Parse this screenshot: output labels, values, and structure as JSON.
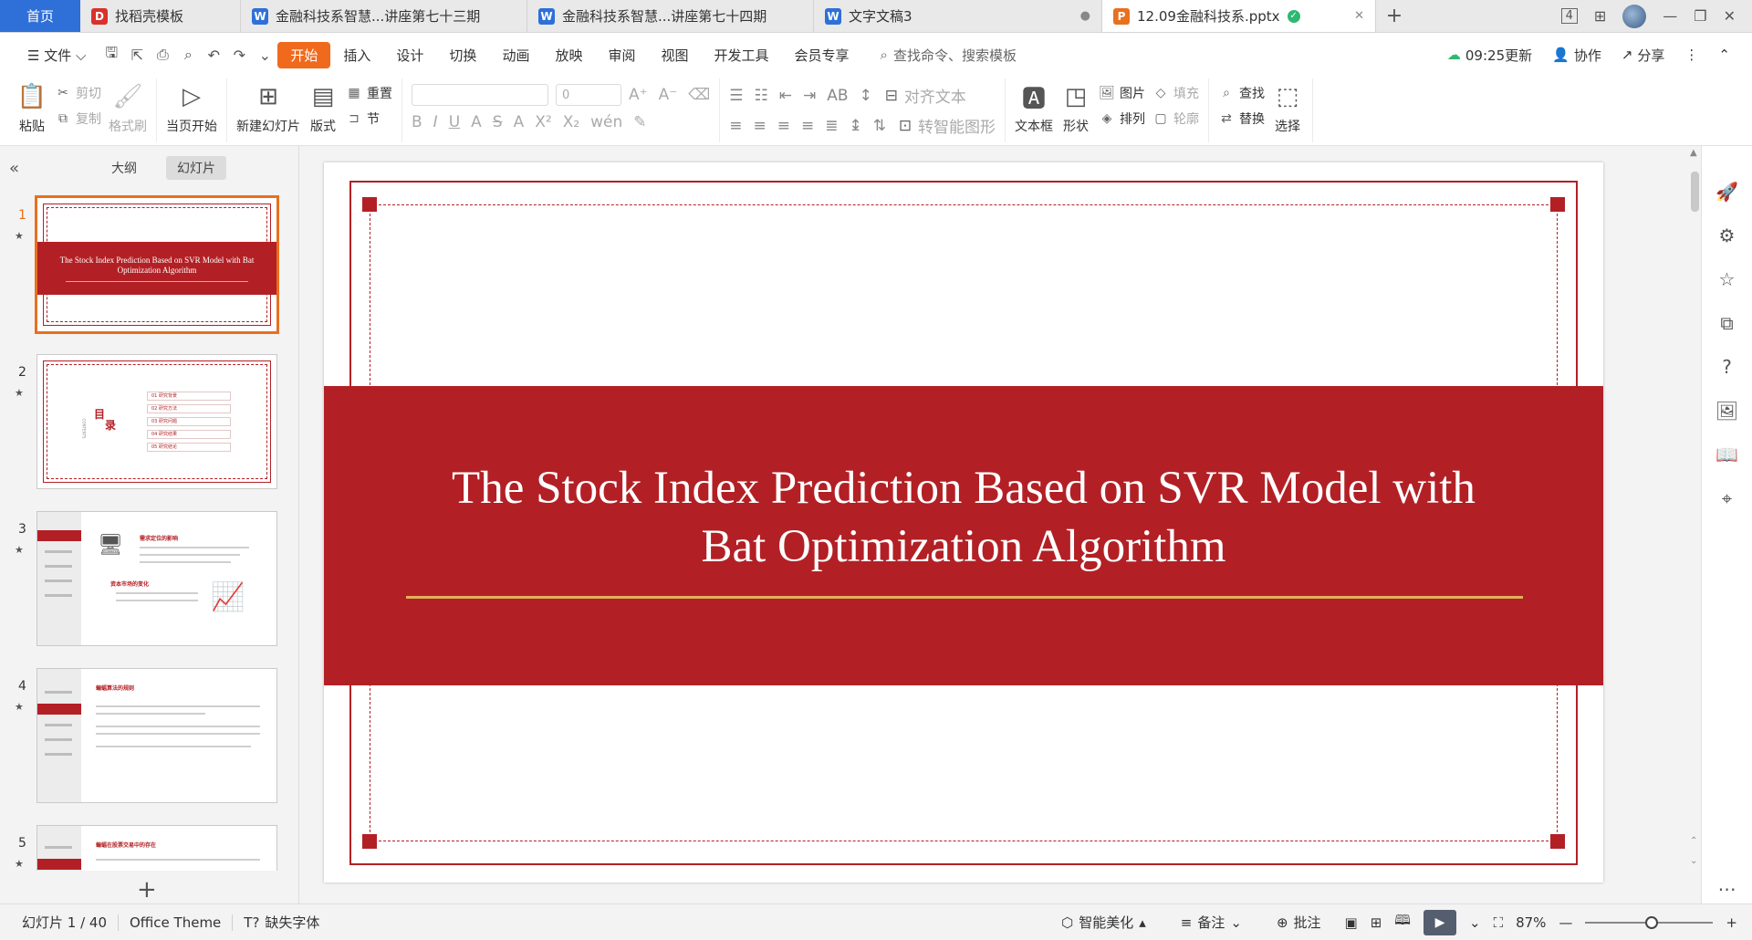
{
  "tabs": {
    "home": "首页",
    "items": [
      {
        "label": "找稻壳模板",
        "icon": "D",
        "color": "#d9312b"
      },
      {
        "label": "金融科技系智慧...讲座第七十三期",
        "icon": "W",
        "color": "#2f6fd8"
      },
      {
        "label": "金融科技系智慧...讲座第七十四期",
        "icon": "W",
        "color": "#2f6fd8"
      },
      {
        "label": "文字文稿3",
        "icon": "W",
        "color": "#2f6fd8"
      },
      {
        "label": "12.09金融科技系.pptx",
        "icon": "P",
        "color": "#e8701e"
      }
    ],
    "badge": "4"
  },
  "menu": {
    "file": "文件",
    "items": [
      "开始",
      "插入",
      "设计",
      "切换",
      "动画",
      "放映",
      "审阅",
      "视图",
      "开发工具",
      "会员专享"
    ],
    "search": "查找命令、搜索模板",
    "update_time": "09:25更新",
    "collab": "协作",
    "share": "分享"
  },
  "ribbon": {
    "paste": "粘贴",
    "cut": "剪切",
    "copy": "复制",
    "format_painter": "格式刷",
    "from_current": "当页开始",
    "new_slide": "新建幻灯片",
    "layout": "版式",
    "reset": "重置",
    "section": "节",
    "font_size": "0",
    "align_text": "对齐文本",
    "smart_graphic": "转智能图形",
    "textbox": "文本框",
    "shape": "形状",
    "picture": "图片",
    "arrange": "排列",
    "fill": "填充",
    "outline": "轮廓",
    "find": "查找",
    "replace": "替换",
    "select": "选择"
  },
  "panel": {
    "outline_tab": "大纲",
    "slides_tab": "幻灯片",
    "thumb1_title": "The Stock Index Prediction Based on SVR Model with Bat Optimization Algorithm",
    "thumb2_heading_a": "目",
    "thumb2_heading_b": "录",
    "thumb2_side": "CONTENTS",
    "toc": [
      "01 研究背景",
      "02 研究方法",
      "03 研究问题",
      "04 研究结果",
      "05 研究结论"
    ],
    "thumb3_h1": "需求定位的影响",
    "thumb3_h2": "资本市场的变化",
    "thumb4_h1": "蝙蝠算法的规则",
    "thumb5_h1": "蝙蝠在股票交易中的存在",
    "thumb_numbers": [
      "1",
      "2",
      "3",
      "4",
      "5"
    ]
  },
  "slide": {
    "title_line1": "The Stock Index Prediction Based on SVR Model with",
    "title_line2": "Bat Optimization Algorithm",
    "accent": "#b22025",
    "gold": "#e2b15a"
  },
  "status": {
    "slide_counter": "幻灯片 1 / 40",
    "theme": "Office Theme",
    "missing_font": "缺失字体",
    "beautify": "智能美化",
    "notes": "备注",
    "comments": "批注",
    "zoom": "87%"
  }
}
